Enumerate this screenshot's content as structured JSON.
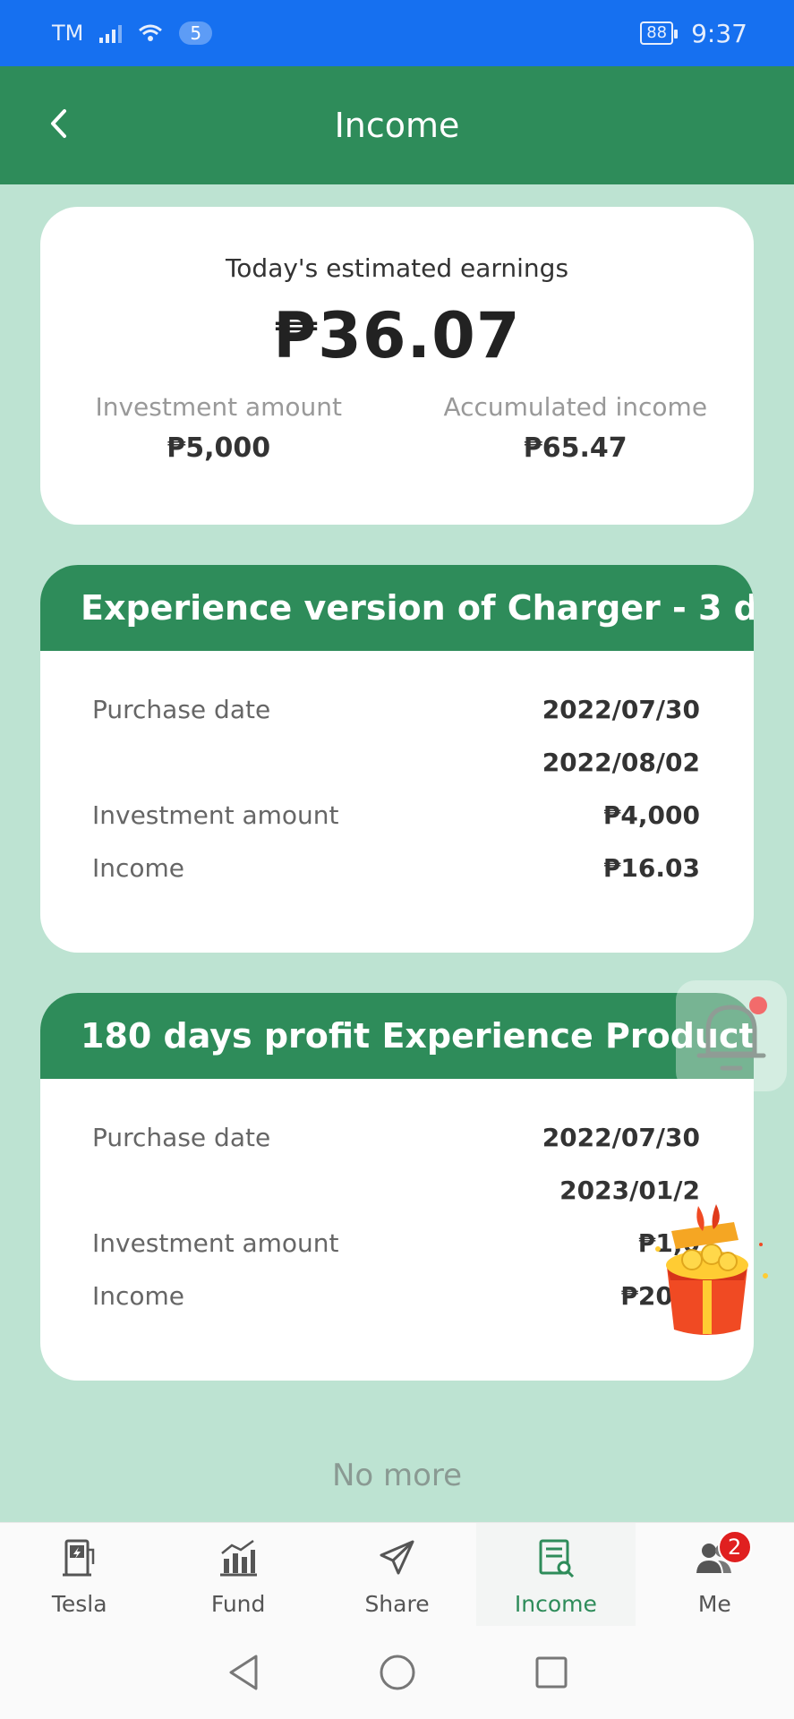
{
  "status_bar": {
    "carrier": "TM",
    "wifi_count": "5",
    "battery": "88",
    "time": "9:37"
  },
  "header": {
    "title": "Income"
  },
  "summary": {
    "today_label": "Today's estimated earnings",
    "today_value": "₱36.07",
    "investment_label": "Investment amount",
    "investment_value": "₱5,000",
    "accumulated_label": "Accumulated income",
    "accumulated_value": "₱65.47"
  },
  "products": [
    {
      "title": "Experience version of Charger - 3 d...",
      "purchase_label": "Purchase date",
      "purchase_date": "2022/07/30",
      "end_date": "2022/08/02",
      "investment_label": "Investment amount",
      "investment_value": "₱4,000",
      "income_label": "Income",
      "income_value": "₱16.03"
    },
    {
      "title": "180 days profit Experience Product",
      "purchase_label": "Purchase date",
      "purchase_date": "2022/07/30",
      "end_date": "2023/01/2",
      "investment_label": "Investment amount",
      "investment_value": "₱1,0",
      "income_label": "Income",
      "income_value": "₱20.0"
    }
  ],
  "footer_note": "No more",
  "bottom_nav": [
    {
      "label": "Tesla",
      "icon": "charger-icon"
    },
    {
      "label": "Fund",
      "icon": "bar-chart-icon"
    },
    {
      "label": "Share",
      "icon": "paper-plane-icon"
    },
    {
      "label": "Income",
      "icon": "income-doc-icon",
      "active": true
    },
    {
      "label": "Me",
      "icon": "users-icon",
      "badge": "2"
    }
  ],
  "colors": {
    "primary": "#2e8c5a",
    "background": "#bde3d2",
    "status_bar": "#1670f0",
    "badge": "#e02020"
  }
}
